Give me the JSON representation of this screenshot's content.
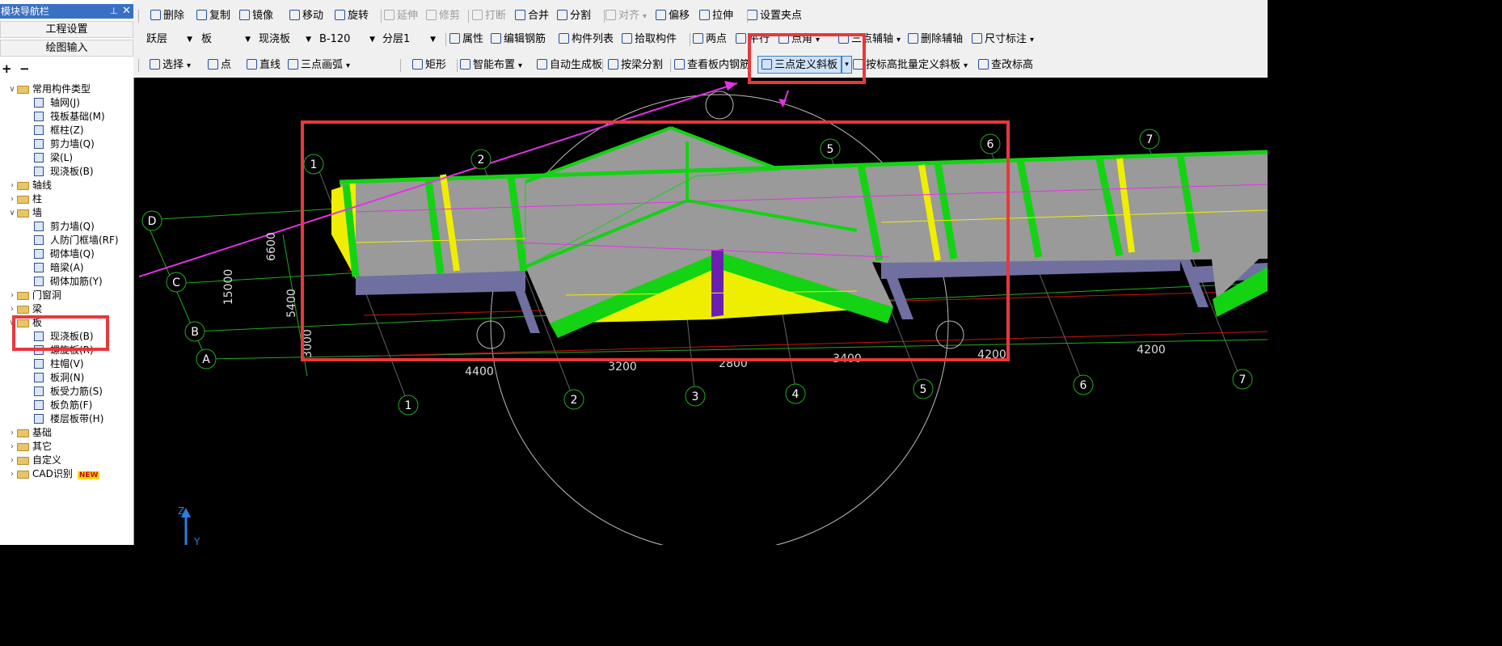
{
  "nav": {
    "title": "模块导航栏",
    "pin_glyph": "⊥",
    "close_glyph": "✕",
    "buttons": [
      "工程设置",
      "绘图输入"
    ],
    "tree_add_glyph": "+",
    "tree_remove_glyph": "−",
    "tree": [
      {
        "label": "常用构件类型",
        "expander": "∨",
        "folder": true,
        "level": 0
      },
      {
        "label": "轴网(J)",
        "level": 1,
        "icon": "grid-icon"
      },
      {
        "label": "筏板基础(M)",
        "level": 1,
        "icon": "raft-icon"
      },
      {
        "label": "框柱(Z)",
        "level": 1,
        "icon": "column-icon"
      },
      {
        "label": "剪力墙(Q)",
        "level": 1,
        "icon": "shear-wall-icon"
      },
      {
        "label": "梁(L)",
        "level": 1,
        "icon": "beam-icon"
      },
      {
        "label": "现浇板(B)",
        "level": 1,
        "icon": "slab-icon"
      },
      {
        "label": "轴线",
        "expander": "›",
        "folder": true,
        "level": 0
      },
      {
        "label": "柱",
        "expander": "›",
        "folder": true,
        "level": 0
      },
      {
        "label": "墙",
        "expander": "∨",
        "folder": true,
        "level": 0
      },
      {
        "label": "剪力墙(Q)",
        "level": 1,
        "icon": "shear-wall-icon"
      },
      {
        "label": "人防门框墙(RF)",
        "level": 1,
        "icon": "door-wall-icon"
      },
      {
        "label": "砌体墙(Q)",
        "level": 1,
        "icon": "masonry-wall-icon"
      },
      {
        "label": "暗梁(A)",
        "level": 1,
        "icon": "hidden-beam-icon"
      },
      {
        "label": "砌体加筋(Y)",
        "level": 1,
        "icon": "masonry-rebar-icon"
      },
      {
        "label": "门窗洞",
        "expander": "›",
        "folder": true,
        "level": 0
      },
      {
        "label": "梁",
        "expander": "›",
        "folder": true,
        "level": 0
      },
      {
        "label": "板",
        "expander": "∨",
        "folder": true,
        "level": 0
      },
      {
        "label": "现浇板(B)",
        "level": 1,
        "icon": "slab-icon"
      },
      {
        "label": "螺旋板(R)",
        "level": 1,
        "icon": "spiral-slab-icon"
      },
      {
        "label": "柱帽(V)",
        "level": 1,
        "icon": "column-cap-icon"
      },
      {
        "label": "板洞(N)",
        "level": 1,
        "icon": "slab-hole-icon"
      },
      {
        "label": "板受力筋(S)",
        "level": 1,
        "icon": "slab-rebar-icon"
      },
      {
        "label": "板负筋(F)",
        "level": 1,
        "icon": "negative-rebar-icon"
      },
      {
        "label": "楼层板带(H)",
        "level": 1,
        "icon": "floor-strip-icon"
      },
      {
        "label": "基础",
        "expander": "›",
        "folder": true,
        "level": 0
      },
      {
        "label": "其它",
        "expander": "›",
        "folder": true,
        "level": 0
      },
      {
        "label": "自定义",
        "expander": "›",
        "folder": true,
        "level": 0
      },
      {
        "label": "CAD识别",
        "expander": "›",
        "folder": true,
        "level": 0,
        "badge": "NEW"
      }
    ]
  },
  "toolbar1": [
    {
      "label": "删除",
      "icon": "delete-icon"
    },
    {
      "label": "复制",
      "icon": "copy-icon"
    },
    {
      "label": "镜像",
      "icon": "mirror-icon"
    },
    {
      "label": "移动",
      "icon": "move-icon"
    },
    {
      "label": "旋转",
      "icon": "rotate-icon"
    },
    {
      "label": "延伸",
      "icon": "extend-icon",
      "disabled": true
    },
    {
      "label": "修剪",
      "icon": "trim-icon",
      "disabled": true
    },
    {
      "label": "打断",
      "icon": "break-icon",
      "disabled": true
    },
    {
      "label": "合并",
      "icon": "merge-icon"
    },
    {
      "label": "分割",
      "icon": "split-icon"
    },
    {
      "label": "对齐",
      "icon": "align-icon",
      "disabled": true,
      "dropdown": "▾"
    },
    {
      "label": "偏移",
      "icon": "offset-icon"
    },
    {
      "label": "拉伸",
      "icon": "stretch-icon"
    },
    {
      "label": "设置夹点",
      "icon": "grip-icon"
    }
  ],
  "toolbar2": {
    "selects": [
      "跃层",
      "板",
      "现浇板",
      "B-120",
      "分层1"
    ],
    "tools": [
      {
        "label": "属性",
        "icon": "property-icon"
      },
      {
        "label": "编辑钢筋",
        "icon": "edit-rebar-icon"
      },
      {
        "label": "构件列表",
        "icon": "component-list-icon"
      },
      {
        "label": "拾取构件",
        "icon": "pick-icon"
      },
      {
        "label": "两点",
        "icon": "two-point-icon"
      },
      {
        "label": "平行",
        "icon": "parallel-icon"
      },
      {
        "label": "点角",
        "icon": "point-angle-icon",
        "dropdown": "▾"
      },
      {
        "label": "三点辅轴",
        "icon": "three-point-axis-icon",
        "dropdown": "▾"
      },
      {
        "label": "删除辅轴",
        "icon": "delete-axis-icon"
      },
      {
        "label": "尺寸标注",
        "icon": "dimension-icon",
        "dropdown": "▾"
      }
    ]
  },
  "toolbar3": [
    {
      "label": "选择",
      "icon": "select-arrow-icon",
      "dropdown": "▾"
    },
    {
      "label": "点",
      "icon": "point-icon"
    },
    {
      "label": "直线",
      "icon": "line-icon"
    },
    {
      "label": "三点画弧",
      "icon": "arc-icon",
      "dropdown": "▾"
    },
    {
      "label": "矩形",
      "icon": "rect-icon"
    },
    {
      "label": "智能布置",
      "icon": "smart-layout-icon",
      "dropdown": "▾"
    },
    {
      "label": "自动生成板",
      "icon": "auto-slab-icon"
    },
    {
      "label": "按梁分割",
      "icon": "split-by-beam-icon"
    },
    {
      "label": "查看板内钢筋",
      "icon": "view-rebar-icon"
    },
    {
      "label": "三点定义斜板",
      "icon": "three-point-slope-icon",
      "active": true,
      "dropdown": "▾"
    },
    {
      "label": "按标高批量定义斜板",
      "icon": "batch-slope-icon",
      "dropdown": "▾"
    },
    {
      "label": "查改标高",
      "icon": "elevation-icon"
    }
  ],
  "scene": {
    "axes_top": [
      "1",
      "2",
      "5",
      "6",
      "7"
    ],
    "axes_bottom": [
      "1",
      "2",
      "3",
      "4",
      "5",
      "6",
      "7"
    ],
    "axes_left": [
      "D",
      "C",
      "B",
      "A"
    ],
    "dims_bottom": [
      "4400",
      "3200",
      "2800",
      "3400",
      "4200",
      "4200"
    ],
    "dims_left": [
      "6600",
      "15000",
      "5400",
      "3000"
    ],
    "coord_axes": [
      "Z",
      "Y"
    ],
    "colors": {
      "beam": "#13d313",
      "slab": "#9a9a9a",
      "wall": "#6f6fa0",
      "yellow": "#f0ee00",
      "magenta": "#e432e4",
      "purple": "#6a1fb0",
      "red_highlight": "#e8383d",
      "grid_red": "#cc1111",
      "grid_green": "#22aa22"
    }
  }
}
